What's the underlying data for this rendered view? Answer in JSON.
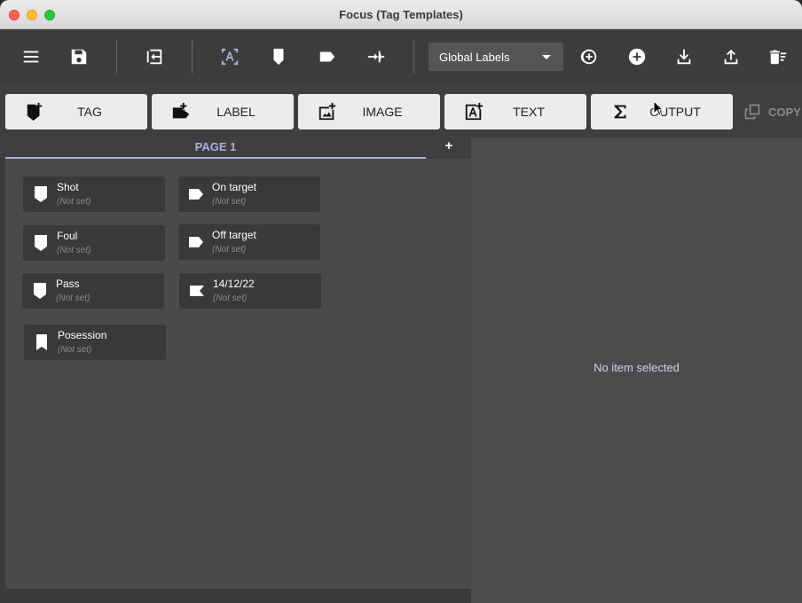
{
  "window": {
    "title": "Focus (Tag Templates)"
  },
  "toolbar": {
    "global_labels": "Global Labels",
    "icons": [
      "menu-icon",
      "save-icon",
      "exit-icon",
      "text-frame-icon",
      "tag-icon",
      "label-icon",
      "compare-icon",
      "add-circle-outline-icon",
      "add-circle-icon",
      "download-icon",
      "upload-icon",
      "delete-sweep-icon"
    ]
  },
  "typebar": {
    "buttons": [
      {
        "label": "TAG",
        "icon": "add-tag-icon"
      },
      {
        "label": "LABEL",
        "icon": "add-label-icon"
      },
      {
        "label": "IMAGE",
        "icon": "add-image-icon"
      },
      {
        "label": "TEXT",
        "icon": "add-text-icon"
      },
      {
        "label": "OUTPUT",
        "icon": "sigma-icon"
      }
    ],
    "copy_label": "COPY"
  },
  "tabs": {
    "page_label": "PAGE 1",
    "add_label": "+"
  },
  "tags": [
    {
      "name": "Shot",
      "value": "(Not set)",
      "shape": "tag"
    },
    {
      "name": "On target",
      "value": "(Not set)",
      "shape": "label"
    },
    {
      "name": "Foul",
      "value": "(Not set)",
      "shape": "tag"
    },
    {
      "name": "Off target",
      "value": "(Not set)",
      "shape": "label"
    },
    {
      "name": "Pass",
      "value": "(Not set)",
      "shape": "tag"
    },
    {
      "name": "14/12/22",
      "value": "(Not set)",
      "shape": "flag"
    },
    {
      "name": "Posession",
      "value": "(Not set)",
      "shape": "bookmark"
    }
  ],
  "detail": {
    "empty_text": "No item selected"
  },
  "colors": {
    "accent": "#a9b0dd",
    "panel": "#4a4a4a",
    "tag_bg": "#393939"
  }
}
